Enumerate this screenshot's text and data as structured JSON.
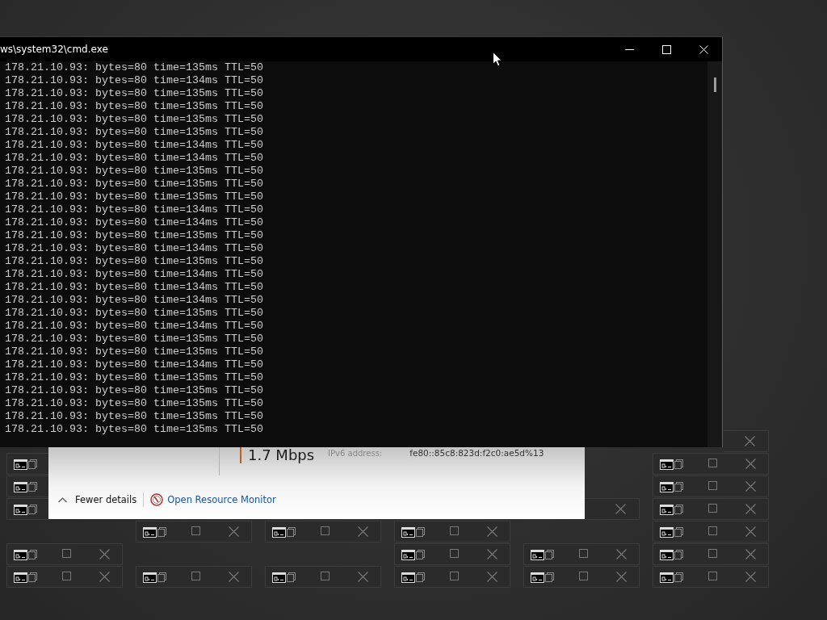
{
  "console_window": {
    "title": "ws\\system32\\cmd.exe",
    "lines": [
      "178.21.10.93: bytes=80 time=135ms TTL=50",
      "178.21.10.93: bytes=80 time=134ms TTL=50",
      "178.21.10.93: bytes=80 time=135ms TTL=50",
      "178.21.10.93: bytes=80 time=135ms TTL=50",
      "178.21.10.93: bytes=80 time=135ms TTL=50",
      "178.21.10.93: bytes=80 time=135ms TTL=50",
      "178.21.10.93: bytes=80 time=134ms TTL=50",
      "178.21.10.93: bytes=80 time=134ms TTL=50",
      "178.21.10.93: bytes=80 time=135ms TTL=50",
      "178.21.10.93: bytes=80 time=135ms TTL=50",
      "178.21.10.93: bytes=80 time=135ms TTL=50",
      "178.21.10.93: bytes=80 time=134ms TTL=50",
      "178.21.10.93: bytes=80 time=134ms TTL=50",
      "178.21.10.93: bytes=80 time=135ms TTL=50",
      "178.21.10.93: bytes=80 time=134ms TTL=50",
      "178.21.10.93: bytes=80 time=135ms TTL=50",
      "178.21.10.93: bytes=80 time=134ms TTL=50",
      "178.21.10.93: bytes=80 time=134ms TTL=50",
      "178.21.10.93: bytes=80 time=134ms TTL=50",
      "178.21.10.93: bytes=80 time=135ms TTL=50",
      "178.21.10.93: bytes=80 time=134ms TTL=50",
      "178.21.10.93: bytes=80 time=135ms TTL=50",
      "178.21.10.93: bytes=80 time=135ms TTL=50",
      "178.21.10.93: bytes=80 time=134ms TTL=50",
      "178.21.10.93: bytes=80 time=135ms TTL=50",
      "178.21.10.93: bytes=80 time=135ms TTL=50",
      "178.21.10.93: bytes=80 time=135ms TTL=50",
      "178.21.10.93: bytes=80 time=135ms TTL=50",
      "178.21.10.93: bytes=80 time=135ms TTL=50"
    ]
  },
  "task_manager": {
    "speed": "1.7 Mbps",
    "ipv6_label": "IPv6 address:",
    "ipv6_value": "fe80::85c8:823d:f2c0:ae5d%13",
    "fewer_details": "Fewer details",
    "resource_monitor_link": "Open Resource Monitor"
  }
}
